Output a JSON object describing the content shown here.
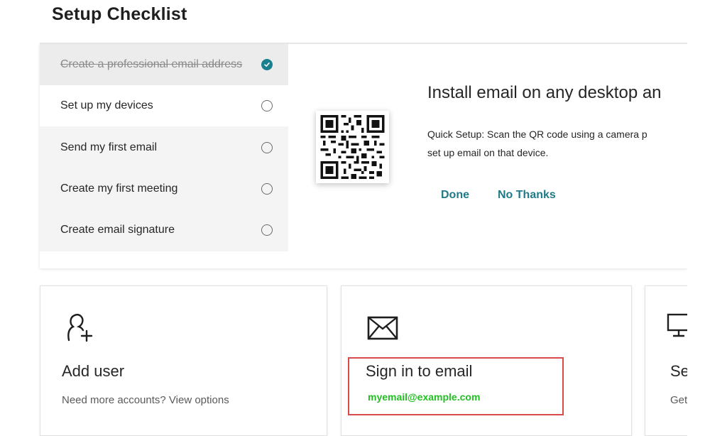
{
  "page": {
    "title": "Setup Checklist"
  },
  "steps": [
    {
      "label": "Create a professional email address",
      "status": "completed"
    },
    {
      "label": "Set up my devices",
      "status": "selected"
    },
    {
      "label": "Send my first email",
      "status": "pending"
    },
    {
      "label": "Create my first meeting",
      "status": "pending"
    },
    {
      "label": "Create email signature",
      "status": "pending"
    }
  ],
  "detail": {
    "title": "Install email on any desktop an",
    "description_line1": "Quick Setup: Scan the QR code using a camera p",
    "description_line2": "set up email on that device.",
    "done_label": "Done",
    "no_thanks_label": "No Thanks",
    "qr_icon": "qr-code"
  },
  "cards": [
    {
      "icon": "add-user-icon",
      "title": "Add user",
      "subtitle": "Need more accounts? View options"
    },
    {
      "icon": "envelope-icon",
      "title": "Sign in to email",
      "email": "myemail@example.com"
    },
    {
      "icon": "monitor-icon",
      "title": "Se",
      "subtitle": "Get"
    }
  ],
  "colors": {
    "accent": "#1f7a8a",
    "check": "#1a7f8f",
    "highlight": "#d94b4b",
    "email_text": "#22c022"
  }
}
